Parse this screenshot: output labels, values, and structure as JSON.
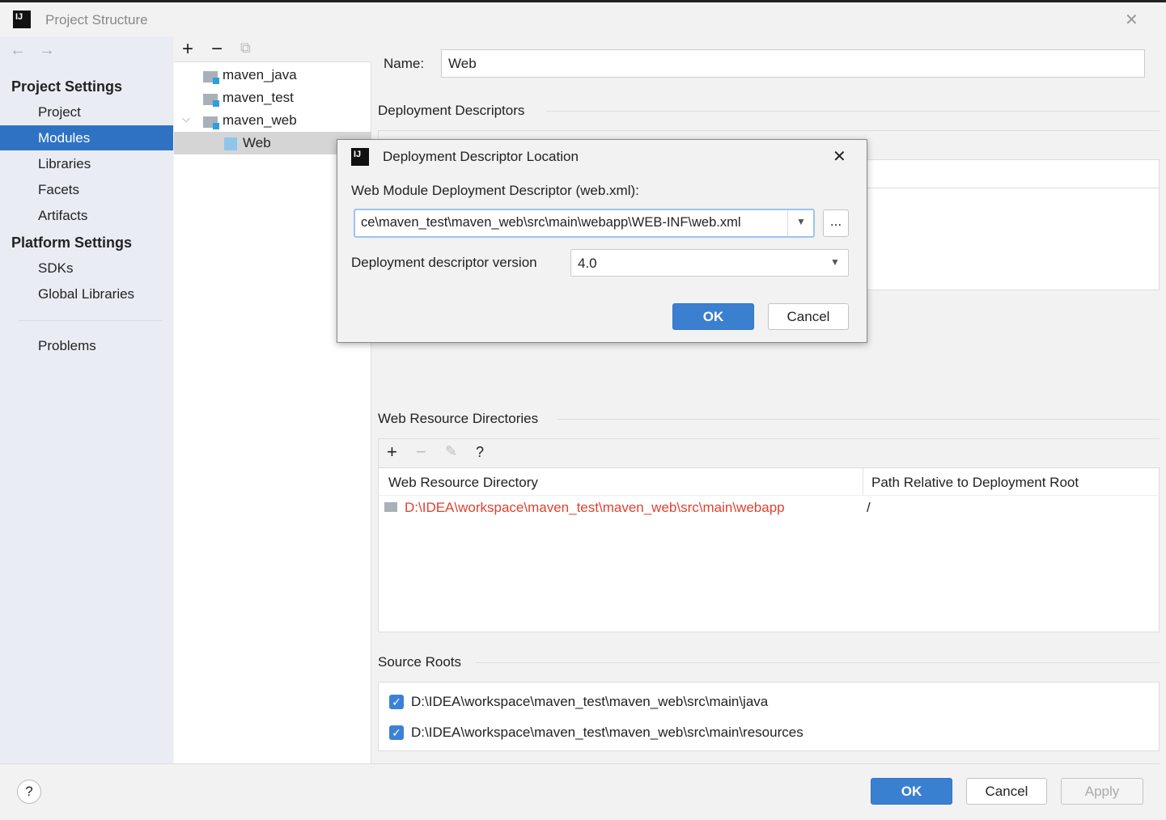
{
  "window": {
    "title": "Project Structure",
    "close": "✕"
  },
  "sidebar": {
    "project_settings": "Project Settings",
    "items": [
      {
        "label": "Project"
      },
      {
        "label": "Modules"
      },
      {
        "label": "Libraries"
      },
      {
        "label": "Facets"
      },
      {
        "label": "Artifacts"
      }
    ],
    "platform_settings": "Platform Settings",
    "platform_items": [
      {
        "label": "SDKs"
      },
      {
        "label": "Global Libraries"
      }
    ],
    "problems": "Problems",
    "selected": "Modules"
  },
  "tree": {
    "items": [
      {
        "label": "maven_java"
      },
      {
        "label": "maven_test"
      },
      {
        "label": "maven_web"
      },
      {
        "label": "Web"
      }
    ],
    "selected": "Web"
  },
  "main": {
    "name_label": "Name:",
    "name_value": "Web",
    "deployment_descriptors": "Deployment Descriptors",
    "web_resource_directories": "Web Resource Directories",
    "wrd_columns": [
      "Web Resource Directory",
      "Path Relative to Deployment Root"
    ],
    "wrd_rows": [
      {
        "dir": "D:\\IDEA\\workspace\\maven_test\\maven_web\\src\\main\\webapp",
        "path": "/"
      }
    ],
    "source_roots": "Source Roots",
    "source_root_items": [
      {
        "path": "D:\\IDEA\\workspace\\maven_test\\maven_web\\src\\main\\java",
        "checked": true
      },
      {
        "path": "D:\\IDEA\\workspace\\maven_test\\maven_web\\src\\main\\resources",
        "checked": true
      }
    ]
  },
  "dialog": {
    "title": "Deployment Descriptor Location",
    "descriptor_label": "Web Module Deployment Descriptor (web.xml):",
    "descriptor_value": "ce\\maven_test\\maven_web\\src\\main\\webapp\\WEB-INF\\web.xml",
    "browse": "...",
    "version_label": "Deployment descriptor version",
    "version_value": "4.0",
    "ok": "OK",
    "cancel": "Cancel",
    "close": "✕"
  },
  "footer": {
    "help": "?",
    "ok": "OK",
    "cancel": "Cancel",
    "apply": "Apply"
  },
  "colors": {
    "accent": "#3b7fd0",
    "selection": "#2f72c4",
    "error_path": "#e0412f"
  }
}
